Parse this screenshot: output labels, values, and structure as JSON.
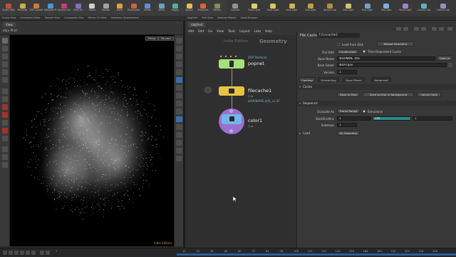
{
  "colors": {
    "node_green": "#a6e07a",
    "node_yellow": "#e8c341",
    "node_blue": "#6fb7e8",
    "node_purple": "#9b6fd0",
    "slider_teal": "#2c8a8a",
    "timeline_blue": "#2a5f9a"
  },
  "shelf": {
    "tools_left": [
      {
        "label": "Bullet RBD",
        "icon": "bullet-icon",
        "color": "#c84a3a"
      },
      {
        "label": "Particles",
        "icon": "particles-icon",
        "color": "#c8b040"
      },
      {
        "label": "POP Location",
        "icon": "pop-location-icon",
        "color": "#d07a30"
      },
      {
        "label": "Attribute Prop",
        "icon": "attribute-icon",
        "color": "#4a9ad0"
      },
      {
        "label": "Volume Solver",
        "icon": "volume-icon",
        "color": "#c83a7a"
      },
      {
        "label": "Shelf Fill",
        "icon": "fill-icon",
        "color": "#8a6ac8"
      },
      {
        "label": "Cloud",
        "icon": "cloud-icon",
        "color": "#d0d0d0"
      },
      {
        "label": "Smoke",
        "icon": "smoke-icon",
        "color": "#a0a0a0"
      },
      {
        "label": "Burst",
        "icon": "burst-icon",
        "color": "#e0a040"
      },
      {
        "label": "Shockwave",
        "icon": "shockwave-icon",
        "color": "#d06040"
      },
      {
        "label": "Vortex",
        "icon": "vortex-icon",
        "color": "#6090d0"
      },
      {
        "label": "Wind",
        "icon": "wind-icon",
        "color": "#70a0c0"
      },
      {
        "label": "Ripple",
        "icon": "ripple-icon",
        "color": "#50b0a0"
      },
      {
        "label": "Sparks",
        "icon": "sparks-icon",
        "color": "#e0c050"
      },
      {
        "label": "Fireworks",
        "icon": "fireworks-icon",
        "color": "#e06040"
      },
      {
        "label": "Debris",
        "icon": "debris-icon",
        "color": "#8a8a5a"
      }
    ],
    "tools_right": [
      {
        "label": "Camera",
        "icon": "camera-icon",
        "color": "#909090"
      },
      {
        "label": "Point Light",
        "icon": "point-light-icon",
        "color": "#e0d070"
      },
      {
        "label": "Spot Light",
        "icon": "spot-light-icon",
        "color": "#e0c060"
      },
      {
        "label": "Area Light",
        "icon": "area-light-icon",
        "color": "#d0b050"
      },
      {
        "label": "Geo Light",
        "icon": "geo-light-icon",
        "color": "#c0a040"
      },
      {
        "label": "Volume Light",
        "icon": "volume-light-icon",
        "color": "#b09040"
      },
      {
        "label": "Dist Light",
        "icon": "distant-light-icon",
        "color": "#d0c070"
      },
      {
        "label": "Env Light",
        "icon": "env-light-icon",
        "color": "#70a0d0"
      },
      {
        "label": "Sky Light",
        "icon": "sky-light-icon",
        "color": "#80b0e0"
      },
      {
        "label": "Portal Light",
        "icon": "portal-light-icon",
        "color": "#a080d0"
      },
      {
        "label": "Caustic Light",
        "icon": "caustic-light-icon",
        "color": "#60b0c0"
      },
      {
        "label": "Indirect Light",
        "icon": "indirect-light-icon",
        "color": "#9090c0"
      }
    ]
  },
  "pane_tabs_left": [
    "Scene View",
    "Animation Editor",
    "Render View",
    "Composite View",
    "Motion FX View",
    "Geometry Spreadsheet"
  ],
  "pane_tabs_right": [
    "/obj/test",
    "Tree View",
    "Material Palette",
    "Asset Browser"
  ],
  "viewport": {
    "tab_label": "View",
    "path": "obj",
    "path_node": "flt.bl",
    "persp_label": "Persp",
    "cam_label": "No cam",
    "footer_label": "Indie Edition"
  },
  "network": {
    "tab_label": "/obj/test",
    "path": "obj",
    "path_node": "test",
    "menu": [
      "Add",
      "Edit",
      "Go",
      "View",
      "Tools",
      "Layout",
      "Labs",
      "Help"
    ],
    "watermark_left": "Indie Edition",
    "watermark_right": "Geometry",
    "nodes": {
      "popnet": {
        "name": "popnet",
        "type_label": "DOP Network"
      },
      "filecache": {
        "name": "filecache1",
        "path_label": "$HIP/NAME.$OS_v1.$F"
      },
      "color": {
        "name": "color1"
      }
    }
  },
  "params": {
    "node_type": "File Cache",
    "node_name": "filecache1",
    "load_from_disk_label": "Load from Disk",
    "reload_geometry_label": "Reload Geometry",
    "file_path_label": "File Path",
    "file_path_mode": "Constructed",
    "time_dependent_label": "Time Dependent Cache",
    "base_name_label": "Base Name",
    "base_name_value": "$HIPNAME.$OS",
    "base_folder_label": "Base Folder",
    "base_folder_value": "$HIP/geo",
    "open_in_label": "Open in",
    "version_label": "Version",
    "version_value": "1",
    "tabs": [
      "Caching",
      "Scheduling",
      "Save Filters",
      "Advanced"
    ],
    "cache_folder": "Cache",
    "save_to_disk_label": "Save to Disk",
    "save_background_label": "Save to Disk in Background",
    "cancel_cook_label": "Cancel Cook",
    "sequence_folder": "Sequence",
    "evaluate_as_label": "Evaluate As",
    "evaluate_as_value": "Frame Range",
    "simulation_label": "Simulation",
    "start_end_label": "Start/End/Inc",
    "start_value": "1",
    "end_value": "240",
    "inc_value": "1",
    "substeps_label": "Substeps",
    "substeps_value": "1",
    "load_folder": "Load",
    "load_value": "All Geometry"
  },
  "timeline": {
    "start_frame": "1",
    "end_frame": "240",
    "frame_value": "1",
    "ticks": [
      "12",
      "24",
      "36",
      "48",
      "60",
      "72",
      "84",
      "96",
      "108",
      "120",
      "132",
      "144",
      "156",
      "168",
      "180",
      "192",
      "204",
      "216",
      "228"
    ]
  }
}
